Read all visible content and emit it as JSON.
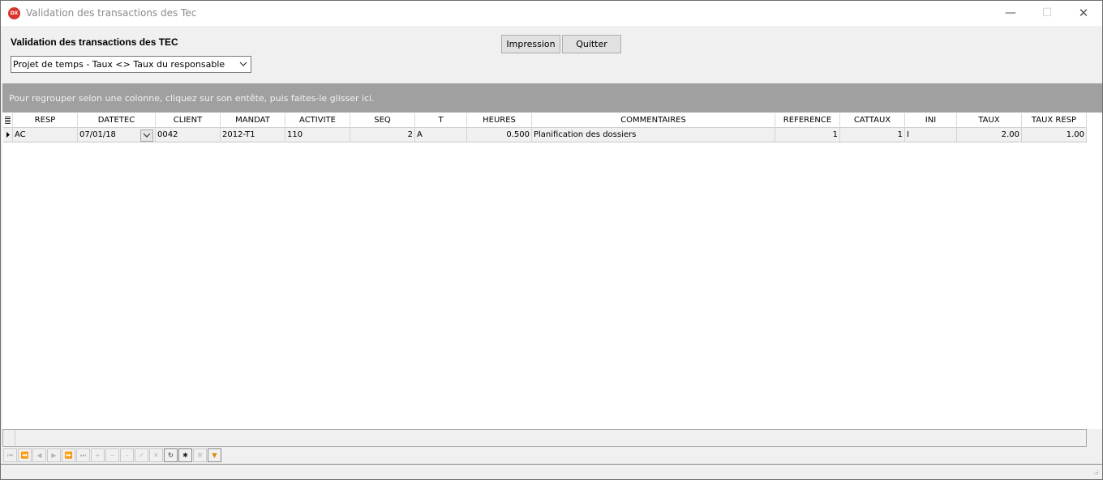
{
  "window": {
    "title": "Validation des transactions des Tec",
    "app_icon": "dx-icon",
    "minimize": "—",
    "maximize": "☐",
    "close": "✕"
  },
  "form": {
    "title": "Validation des transactions des TEC",
    "combo_value": "Projet de temps - Taux <> Taux du responsable",
    "print_label": "Impression",
    "quit_label": "Quitter"
  },
  "grid": {
    "group_hint": "Pour regrouper selon une colonne, cliquez sur son entête, puis faites-le glisser ici.",
    "columns": [
      "RESP",
      "DATETEC",
      "CLIENT",
      "MANDAT",
      "ACTIVITE",
      "SEQ",
      "T",
      "HEURES",
      "COMMENTAIRES",
      "REFERENCE",
      "CATTAUX",
      "INI",
      "TAUX",
      "TAUX RESP"
    ],
    "rows": [
      {
        "resp": "AC",
        "datetec": "07/01/18",
        "client": "0042",
        "mandat": "2012-T1",
        "activite": "110",
        "seq": "2",
        "t": "A",
        "heures": "0.500",
        "commentaires": "Planification des dossiers",
        "reference": "1",
        "cattaux": "1",
        "ini": "I",
        "taux": "2.00",
        "taux_resp": "1.00"
      }
    ]
  },
  "navigator": {
    "buttons": [
      "first-icon",
      "prior-page-icon",
      "prior-icon",
      "next-icon",
      "next-page-icon",
      "last-icon",
      "insert-icon",
      "delete-icon",
      "edit-icon",
      "post-icon",
      "cancel-icon",
      "refresh-icon",
      "bookmark-icon",
      "goto-bookmark-icon",
      "filter-icon"
    ]
  },
  "colors": {
    "accent_filter": "#e08a00",
    "group_panel": "#a0a0a0",
    "app_icon": "#d9342b"
  }
}
